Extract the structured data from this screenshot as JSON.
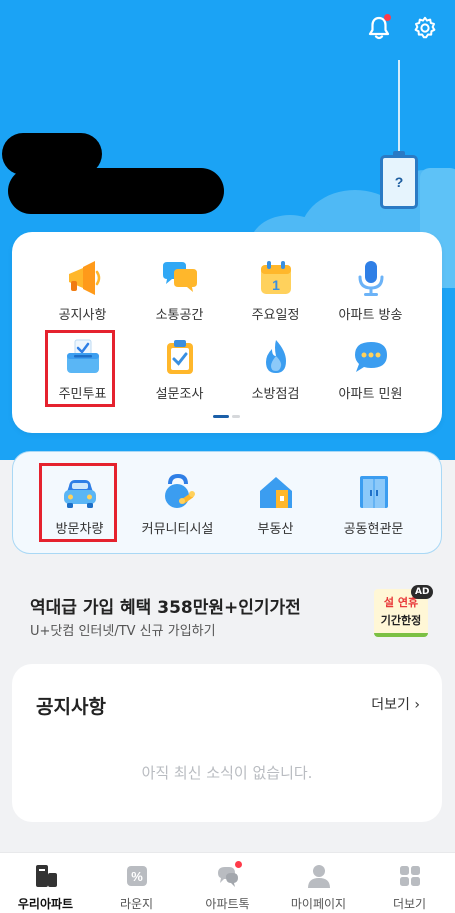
{
  "hero": {
    "id_card_symbol": "?",
    "top_icons": [
      "bell-icon",
      "gear-icon"
    ],
    "bell_has_new": true
  },
  "menu": {
    "items": [
      {
        "label": "공지사항",
        "icon": "megaphone-icon"
      },
      {
        "label": "소통공간",
        "icon": "chat-bubbles-icon"
      },
      {
        "label": "주요일정",
        "icon": "calendar-icon"
      },
      {
        "label": "아파트 방송",
        "icon": "microphone-icon"
      },
      {
        "label": "주민투표",
        "icon": "ballot-box-icon"
      },
      {
        "label": "설문조사",
        "icon": "clipboard-check-icon"
      },
      {
        "label": "소방점검",
        "icon": "fire-icon"
      },
      {
        "label": "아파트 민원",
        "icon": "speech-dots-icon"
      }
    ],
    "page_indicator": {
      "current": 1,
      "total": 2
    }
  },
  "quick": {
    "items": [
      {
        "label": "방문차량",
        "icon": "car-icon"
      },
      {
        "label": "커뮤니티시설",
        "icon": "kettlebell-icon"
      },
      {
        "label": "부동산",
        "icon": "house-icon"
      },
      {
        "label": "공동현관문",
        "icon": "door-icon"
      }
    ]
  },
  "ad": {
    "title": "역대급 가입 혜택 358만원+인기가전",
    "subtitle": "U+닷컴 인터넷/TV 신규 가입하기",
    "badge_line1": "설 연휴",
    "badge_line2": "기간한정",
    "tag": "AD"
  },
  "notice": {
    "title": "공지사항",
    "more": "더보기 ›",
    "empty_text": "아직 최신 소식이 없습니다."
  },
  "bottom_nav": {
    "items": [
      {
        "label": "우리아파트",
        "icon": "apartment-icon",
        "active": true
      },
      {
        "label": "라운지",
        "icon": "percent-icon",
        "active": false
      },
      {
        "label": "아파트톡",
        "icon": "chat-icon",
        "active": false,
        "has_new": true
      },
      {
        "label": "마이페이지",
        "icon": "person-icon",
        "active": false
      },
      {
        "label": "더보기",
        "icon": "grid-icon",
        "active": false
      }
    ]
  },
  "colors": {
    "hero_blue": "#1ba3f5",
    "highlight_red": "#e5222e",
    "accent_navy": "#1b5fa8"
  }
}
